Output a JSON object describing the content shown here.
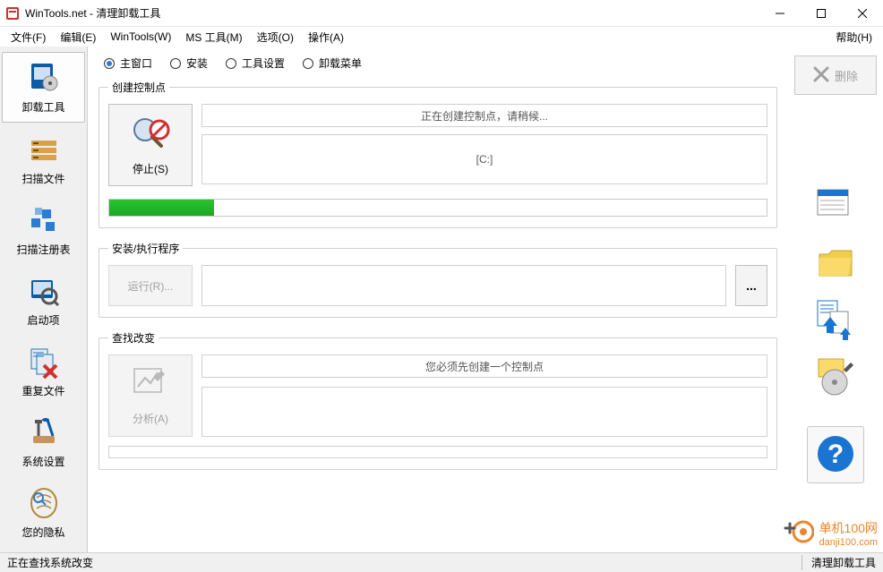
{
  "titlebar": {
    "title": "WinTools.net - 清理卸载工具"
  },
  "menu": {
    "file": "文件(F)",
    "edit": "编辑(E)",
    "wintools": "WinTools(W)",
    "mstools": "MS 工具(M)",
    "options": "选项(O)",
    "actions": "操作(A)",
    "help": "帮助(H)"
  },
  "sidebar": {
    "uninstall": "卸载工具",
    "scan_files": "扫描文件",
    "scan_registry": "扫描注册表",
    "startup": "启动项",
    "duplicates": "重复文件",
    "system_settings": "系统设置",
    "privacy": "您的隐私"
  },
  "tabs": {
    "main": "主窗口",
    "install": "安装",
    "tool_settings": "工具设置",
    "uninstall_menu": "卸载菜单"
  },
  "create_point": {
    "legend": "创建控制点",
    "stop_label": "停止(S)",
    "status_line": "正在创建控制点，请稍候...",
    "drive_line": "[C:]"
  },
  "install_exec": {
    "legend": "安装/执行程序",
    "run_label": "运行(R)...",
    "browse": "..."
  },
  "find_changes": {
    "legend": "查找改变",
    "analyze_label": "分析(A)",
    "hint_line": "您必须先创建一个控制点"
  },
  "right": {
    "delete_label": "删除"
  },
  "status": {
    "left": "正在查找系统改变",
    "right": "清理卸载工具"
  },
  "watermark": {
    "brand": "单机100网",
    "url": "danji100.com"
  },
  "colors": {
    "accent_blue": "#2b7cd3",
    "progress_green": "#1eab28",
    "orange": "#e87817"
  }
}
